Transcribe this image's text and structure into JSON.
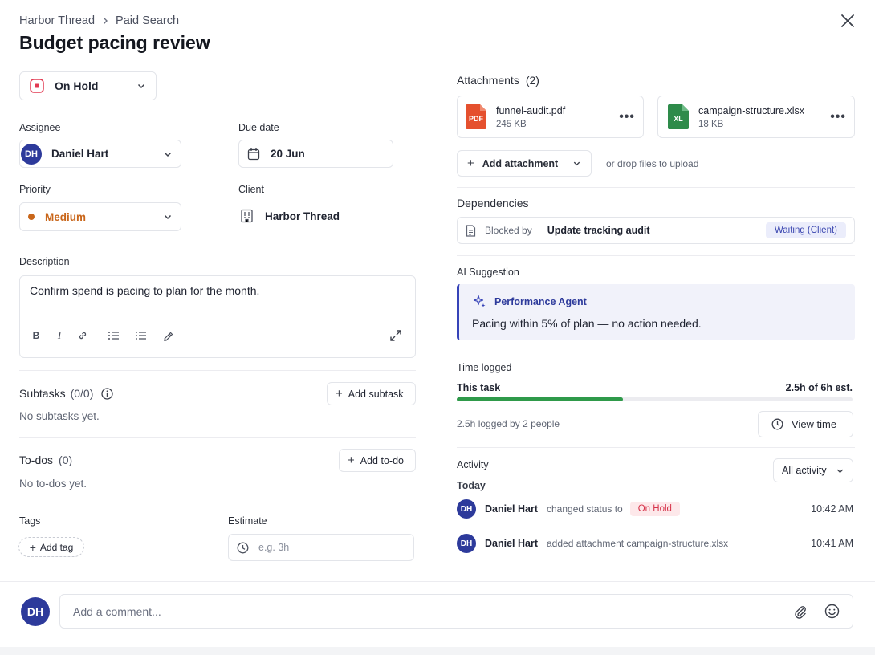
{
  "breadcrumb": {
    "workspace": "Harbor Thread",
    "section": "Paid Search"
  },
  "title": "Budget pacing review",
  "status": {
    "label": "On Hold",
    "color": "#e23a52"
  },
  "fields": {
    "assignee_label": "Assignee",
    "assignee_initials": "DH",
    "assignee_name": "Daniel Hart",
    "due_label": "Due date",
    "due_value": "20 Jun",
    "priority_label": "Priority",
    "priority_value": "Medium",
    "priority_color": "#c9661a",
    "client_label": "Client",
    "client_value": "Harbor Thread"
  },
  "description": {
    "label": "Description",
    "text": "Confirm spend is pacing to plan for the month.",
    "tools": [
      "bold",
      "italic",
      "link",
      "bullet-list",
      "numbered-list",
      "highlight"
    ]
  },
  "subtasks": {
    "label": "Subtasks",
    "count": "(0/0)",
    "empty": "No subtasks yet.",
    "add": "Add subtask"
  },
  "todos": {
    "label": "To-dos",
    "count": "(0)",
    "empty": "No to-dos yet.",
    "add": "Add to-do"
  },
  "tags": {
    "label": "Tags",
    "add": "Add tag"
  },
  "estimate": {
    "label": "Estimate",
    "placeholder": "e.g. 3h"
  },
  "attachments": {
    "label": "Attachments",
    "count": "(2)",
    "files": [
      {
        "name": "funnel-audit.pdf",
        "size": "245 KB",
        "type": "PDF",
        "color": "#e5502e"
      },
      {
        "name": "campaign-structure.xlsx",
        "size": "18 KB",
        "type": "XL",
        "color": "#2e8b4a"
      }
    ],
    "add": "Add attachment",
    "drop_hint": "or drop files to upload"
  },
  "dependencies": {
    "label": "Dependencies",
    "blocked_by": "Blocked by",
    "task": "Update tracking audit",
    "status": "Waiting (Client)"
  },
  "ai": {
    "label": "AI Suggestion",
    "agent": "Performance Agent",
    "message": "Pacing within 5% of plan — no action needed."
  },
  "time": {
    "label": "Time logged",
    "task_label": "This task",
    "summary": "2.5h of 6h est.",
    "progress": 0.42,
    "logged_by": "2.5h logged by 2 people",
    "view": "View time"
  },
  "activity": {
    "label": "Activity",
    "filter": "All activity",
    "day": "Today",
    "items": [
      {
        "initials": "DH",
        "name": "Daniel Hart",
        "action": "changed status to",
        "badge": "On Hold",
        "time": "10:42 AM"
      },
      {
        "initials": "DH",
        "name": "Daniel Hart",
        "action": "added attachment campaign-structure.xlsx",
        "badge": "",
        "time": "10:41 AM"
      }
    ]
  },
  "comment": {
    "initials": "DH",
    "placeholder": "Add a comment..."
  }
}
